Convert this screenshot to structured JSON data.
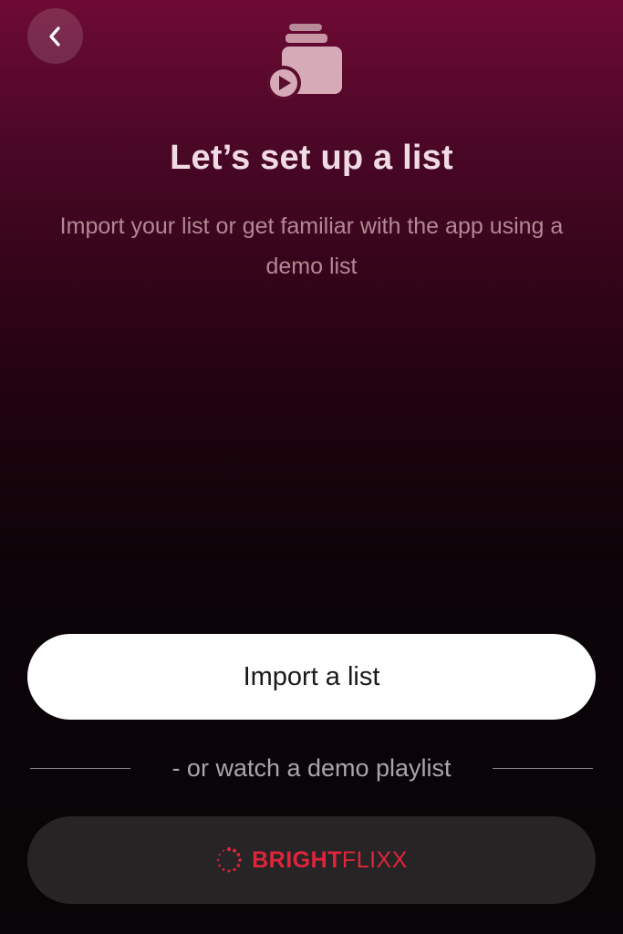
{
  "header": {
    "back_icon": "chevron-left-icon",
    "hero_icon": "stacked-media-play-icon"
  },
  "content": {
    "title": "Let’s set up a list",
    "subtitle": "Import your list or get familiar with the app using a demo list"
  },
  "actions": {
    "import_label": "Import a list",
    "divider_text": "- or watch a demo playlist",
    "demo_brand": {
      "logo_icon": "dotted-circle-logo-icon",
      "name_bold": "BRIGHT",
      "name_light": "FLIXX",
      "color": "#e0243a"
    }
  },
  "colors": {
    "background_top": "#6e0a34",
    "background_bottom": "#070507",
    "primary_button": "#ffffff",
    "secondary_button": "#272426"
  }
}
